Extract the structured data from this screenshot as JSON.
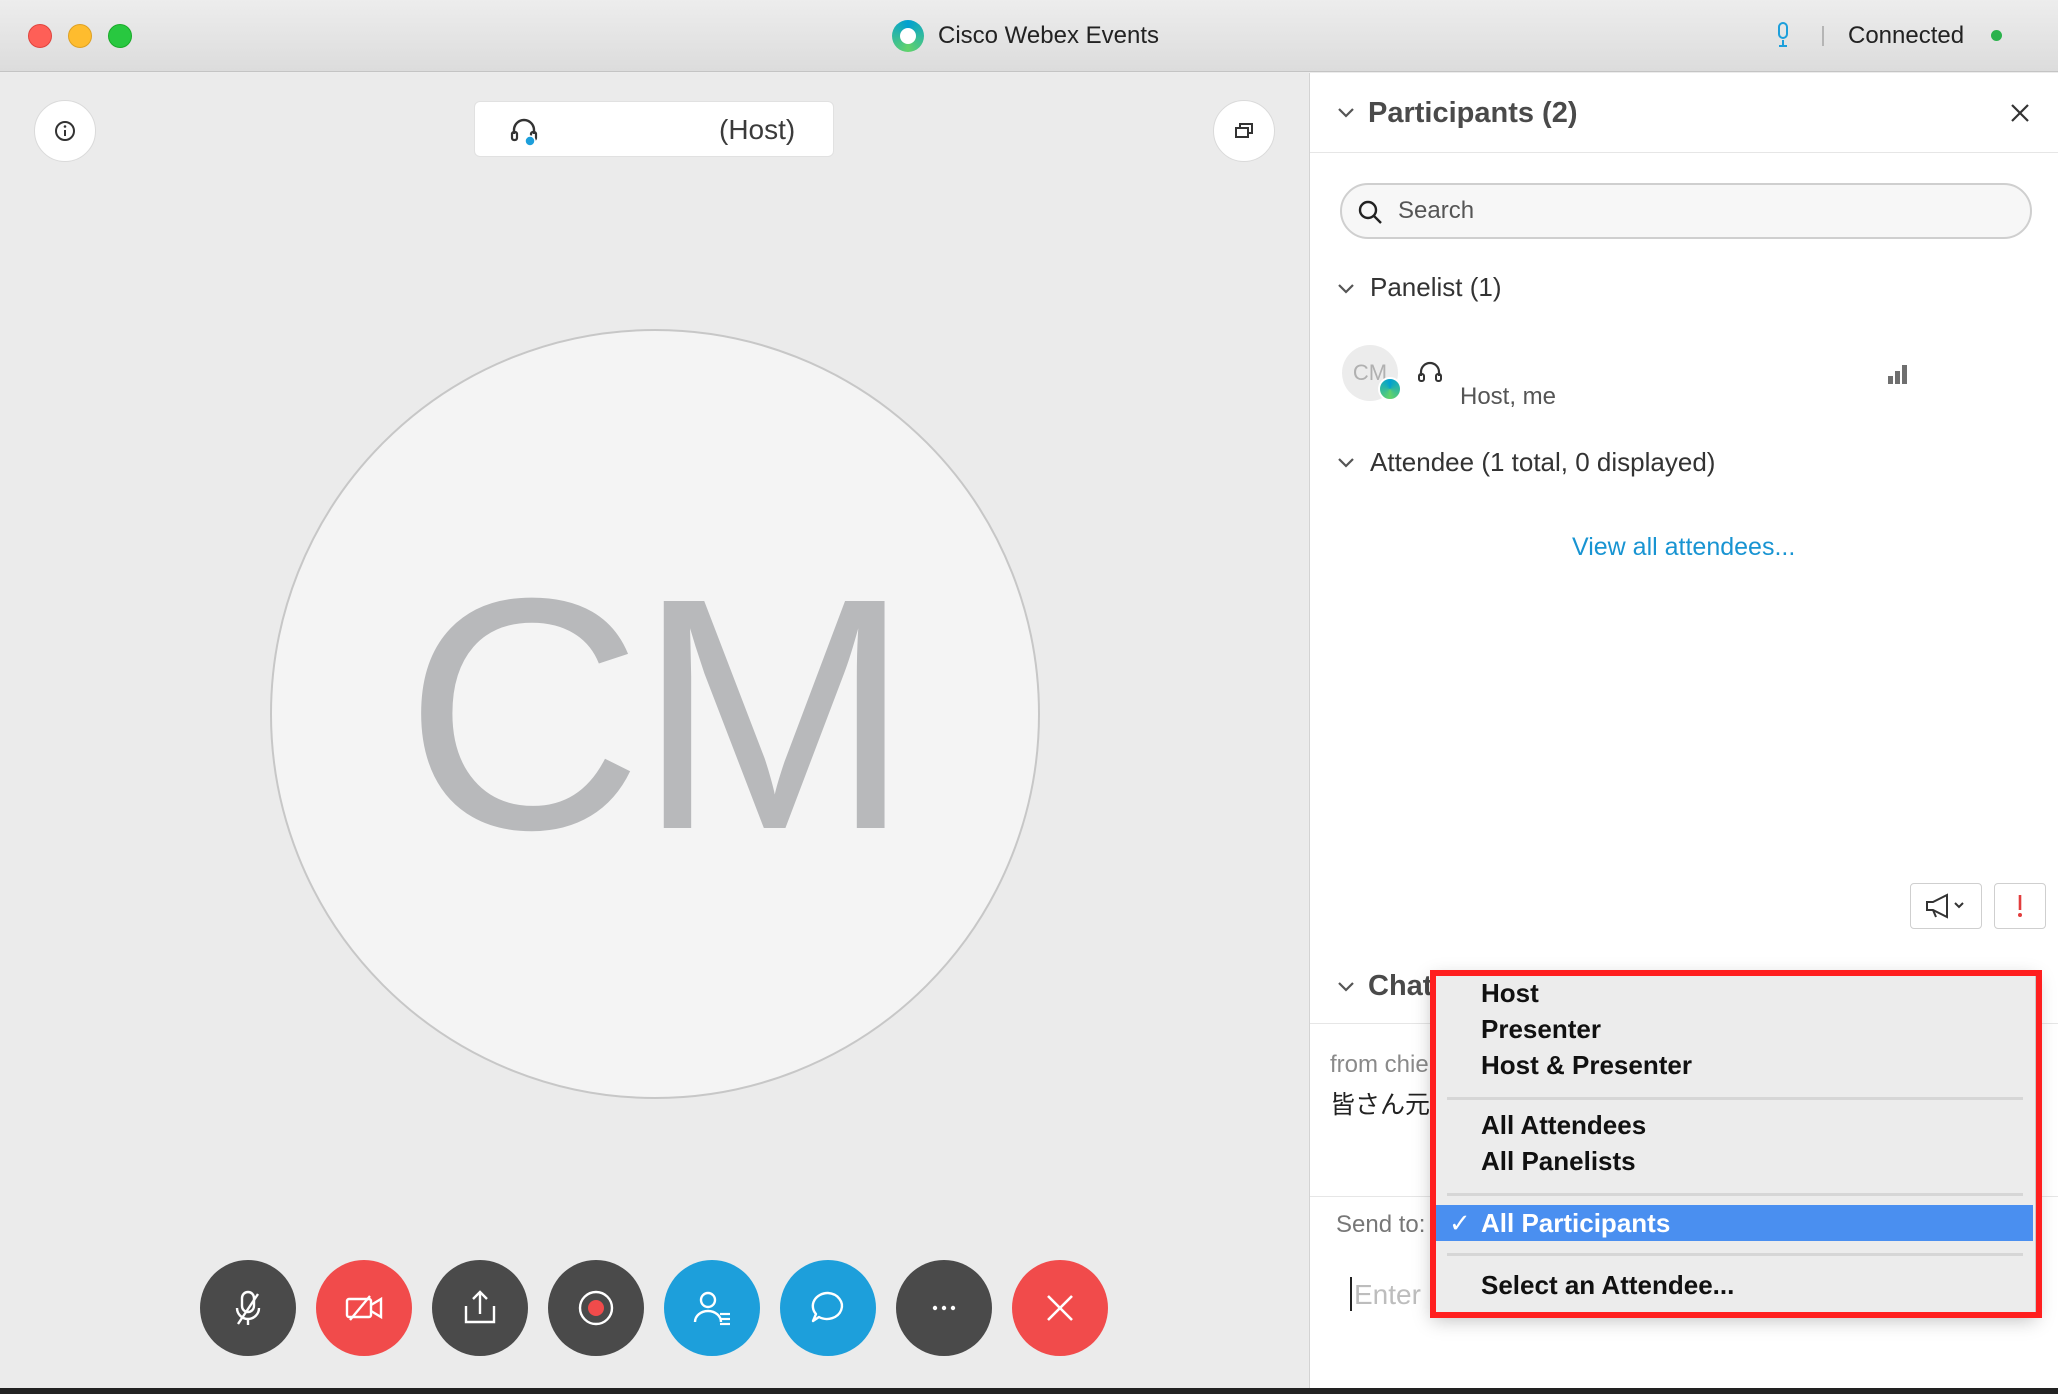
{
  "window": {
    "title": "Cisco Webex Events",
    "connection_status": "Connected"
  },
  "stage": {
    "presenter_name": "",
    "presenter_role": "(Host)",
    "avatar_initials": "CM"
  },
  "controls": [
    {
      "name": "mute-button",
      "icon": "mic-off-icon"
    },
    {
      "name": "video-button",
      "icon": "video-off-icon"
    },
    {
      "name": "share-button",
      "icon": "share-icon"
    },
    {
      "name": "record-button",
      "icon": "record-icon"
    },
    {
      "name": "participants-button",
      "icon": "participants-icon"
    },
    {
      "name": "chat-button",
      "icon": "chat-icon"
    },
    {
      "name": "more-button",
      "icon": "more-icon"
    },
    {
      "name": "leave-button",
      "icon": "close-icon"
    }
  ],
  "participants": {
    "title": "Participants (2)",
    "search_placeholder": "Search",
    "panelist_section": "Panelist (1)",
    "panelist": {
      "initials": "CM",
      "role": "Host, me"
    },
    "attendee_section": "Attendee (1 total, 0 displayed)",
    "view_all": "View all attendees..."
  },
  "chat": {
    "title": "Chat",
    "from": "from chie",
    "message": "皆さん元",
    "send_to_label": "Send to:",
    "input_placeholder": "Enter"
  },
  "send_to_menu": {
    "group1": [
      "Host",
      "Presenter",
      "Host & Presenter"
    ],
    "group2": [
      "All Attendees",
      "All Panelists"
    ],
    "selected": "All Participants",
    "checkmark": "✓",
    "last": "Select an Attendee..."
  },
  "colors": {
    "accent_blue": "#1d9fdb",
    "danger_red": "#f14b4b",
    "link_blue": "#1894d2",
    "menu_selected": "#4a8ff0",
    "annotation_red": "#ff1f1f"
  }
}
